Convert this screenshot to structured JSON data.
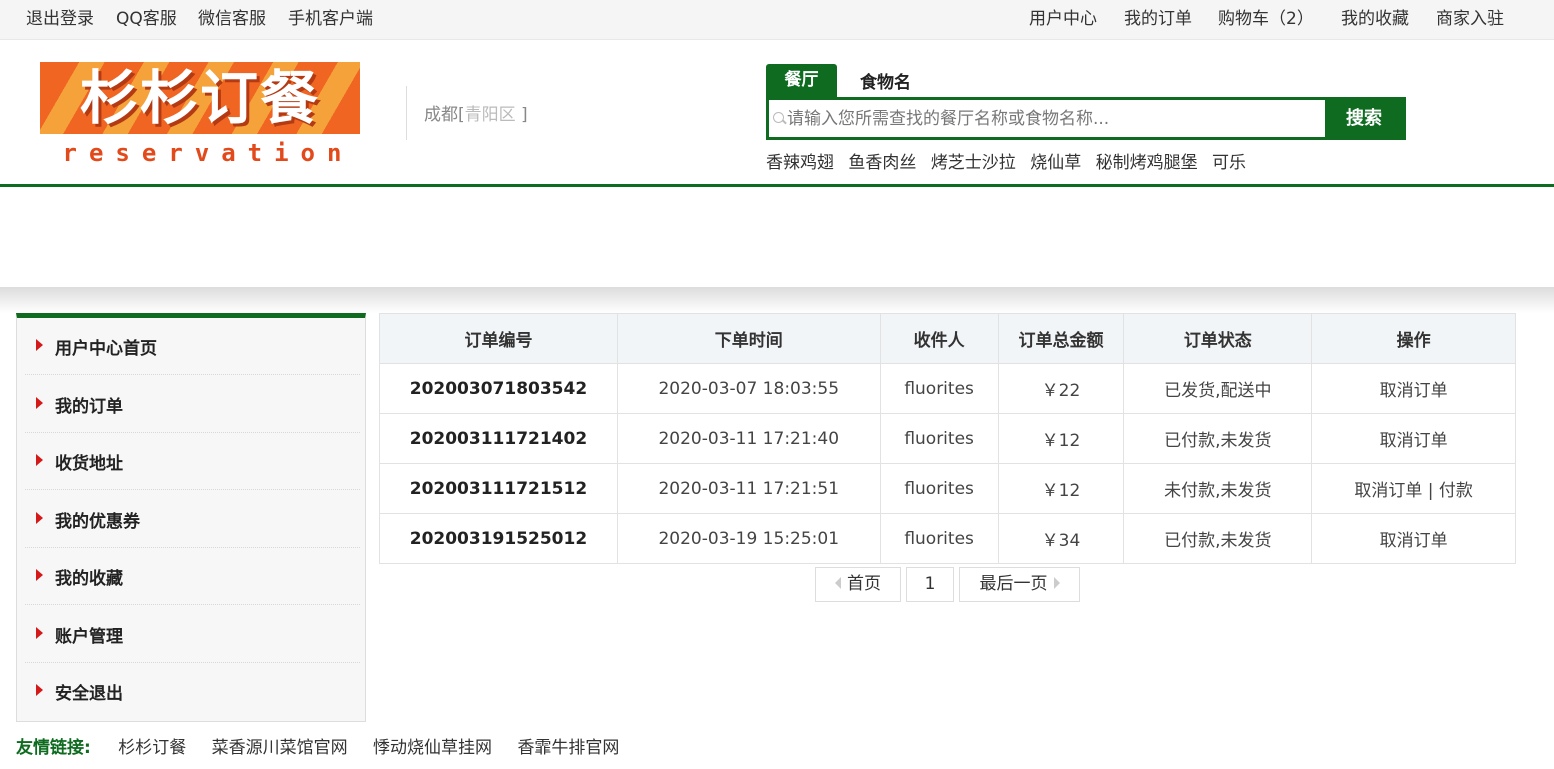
{
  "topbar": {
    "left_links": [
      "退出登录",
      "QQ客服",
      "微信客服",
      "手机客户端"
    ],
    "right_links": [
      "用户中心",
      "我的订单",
      "购物车（2）",
      "我的收藏",
      "商家入驻"
    ]
  },
  "logo": {
    "text_top": "杉杉订餐",
    "text_bottom": "reservation"
  },
  "location": {
    "city": "成都[",
    "district": "青阳区",
    "close": " ]"
  },
  "search": {
    "tabs": [
      "餐厅",
      "食物名"
    ],
    "placeholder": "请输入您所需查找的餐厅名称或食物名称...",
    "button": "搜索",
    "hot": [
      "香辣鸡翅",
      "鱼香肉丝",
      "烤芝士沙拉",
      "烧仙草",
      "秘制烤鸡腿堡",
      "可乐"
    ]
  },
  "sidebar": {
    "items": [
      "用户中心首页",
      "我的订单",
      "收货地址",
      "我的优惠券",
      "我的收藏",
      "账户管理",
      "安全退出"
    ]
  },
  "orders": {
    "headers": [
      "订单编号",
      "下单时间",
      "收件人",
      "订单总金额",
      "订单状态",
      "操作"
    ],
    "rows": [
      {
        "id": "202003071803542",
        "time": "2020-03-07 18:03:55",
        "recipient": "fluorites",
        "amount": "￥22",
        "status": "已发货,配送中",
        "action": "取消订单"
      },
      {
        "id": "202003111721402",
        "time": "2020-03-11 17:21:40",
        "recipient": "fluorites",
        "amount": "￥12",
        "status": "已付款,未发货",
        "action": "取消订单"
      },
      {
        "id": "202003111721512",
        "time": "2020-03-11 17:21:51",
        "recipient": "fluorites",
        "amount": "￥12",
        "status": "未付款,未发货",
        "action": "取消订单 | 付款"
      },
      {
        "id": "202003191525012",
        "time": "2020-03-19 15:25:01",
        "recipient": "fluorites",
        "amount": "￥34",
        "status": "已付款,未发货",
        "action": "取消订单"
      }
    ]
  },
  "pagination": {
    "first": "首页",
    "current": "1",
    "last": "最后一页"
  },
  "friends": {
    "title": "友情链接:",
    "links": [
      "杉杉订餐",
      "菜香源川菜馆官网",
      "悸动烧仙草挂网",
      "香霏牛排官网"
    ]
  },
  "colors": {
    "brand_green": "#0e6b20",
    "arrow_red": "#d51919",
    "logo_orange": "#f06522"
  }
}
